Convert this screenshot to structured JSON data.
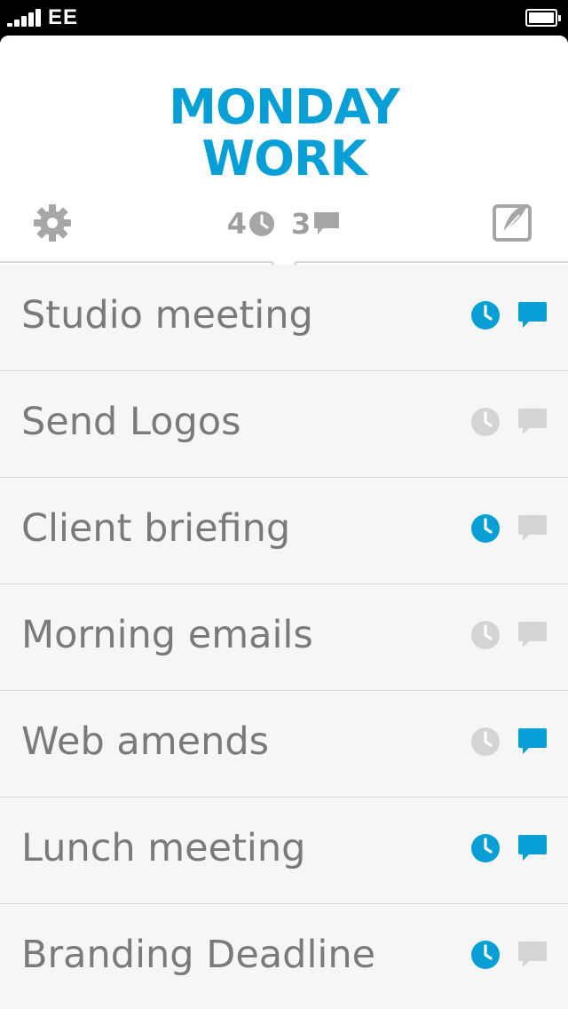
{
  "status_bar": {
    "carrier": "EE",
    "signal_bars": 5,
    "battery_level": 1.0
  },
  "header": {
    "title_line1": "MONDAY",
    "title_line2": "WORK",
    "clock_count": "4",
    "comment_count": "3",
    "icons": {
      "settings": "gear-icon",
      "edit": "edit-icon"
    }
  },
  "colors": {
    "accent": "#089fd6",
    "inactive_icon": "#d4d4d4",
    "header_icon": "#a6a6a6",
    "row_text": "#7a7a7a",
    "row_bg": "#f6f6f6"
  },
  "tasks": [
    {
      "label": "Studio meeting",
      "clock_active": true,
      "comment_active": true
    },
    {
      "label": "Send Logos",
      "clock_active": false,
      "comment_active": false
    },
    {
      "label": "Client briefing",
      "clock_active": true,
      "comment_active": false
    },
    {
      "label": "Morning emails",
      "clock_active": false,
      "comment_active": false
    },
    {
      "label": "Web amends",
      "clock_active": false,
      "comment_active": true
    },
    {
      "label": "Lunch meeting",
      "clock_active": true,
      "comment_active": true
    },
    {
      "label": "Branding Deadline",
      "clock_active": true,
      "comment_active": false
    }
  ]
}
